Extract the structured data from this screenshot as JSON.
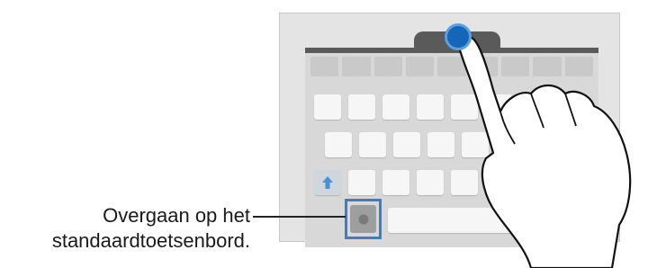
{
  "callout": {
    "line1": "Overgaan op het",
    "line2": "standaardtoetsenbord."
  },
  "icons": {
    "mic": "microphone-icon",
    "hand": "pointing-hand-icon",
    "touch": "touch-point-icon"
  },
  "colors": {
    "highlight": "#3b7ccf",
    "touch": "#1565b8"
  }
}
